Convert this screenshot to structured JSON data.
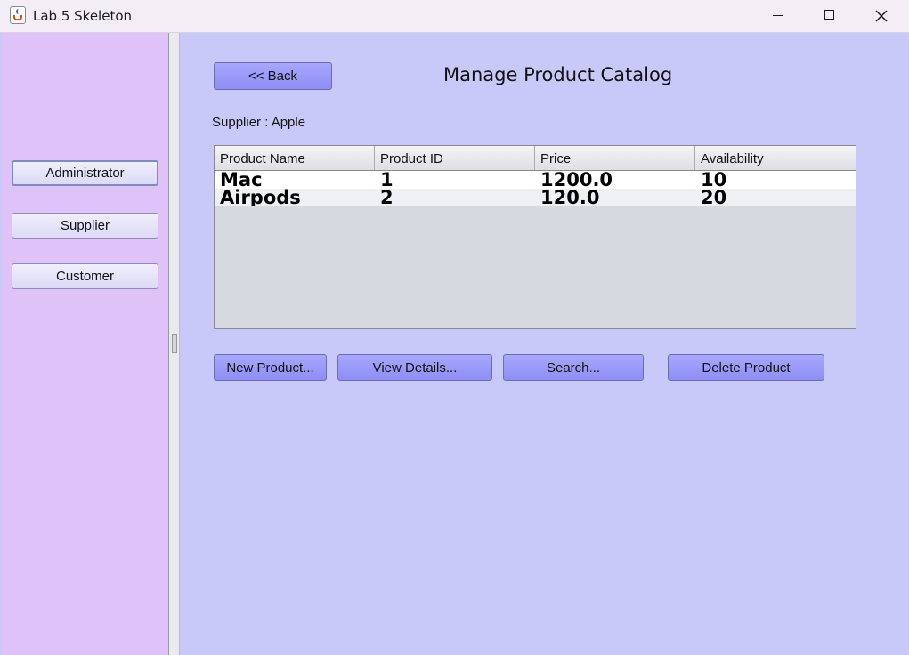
{
  "window": {
    "title": "Lab 5 Skeleton"
  },
  "sidebar": {
    "items": [
      {
        "label": "Administrator"
      },
      {
        "label": "Supplier"
      },
      {
        "label": "Customer"
      }
    ]
  },
  "main": {
    "back_label": "<< Back",
    "title": "Manage Product Catalog",
    "supplier_label": "Supplier : Apple",
    "table": {
      "columns": [
        "Product Name",
        "Product ID",
        "Price",
        "Availability"
      ],
      "rows": [
        [
          "Mac",
          "1",
          "1200.0",
          "10"
        ],
        [
          "Airpods",
          "2",
          "120.0",
          "20"
        ]
      ]
    },
    "actions": {
      "new_product": "New Product...",
      "view_details": "View Details...",
      "search": "Search...",
      "delete_product": "Delete Product"
    }
  },
  "colors": {
    "sidebar_bg": "#dfc3f8",
    "main_bg": "#c9c9f9",
    "button_bg": "#9a9af8"
  }
}
